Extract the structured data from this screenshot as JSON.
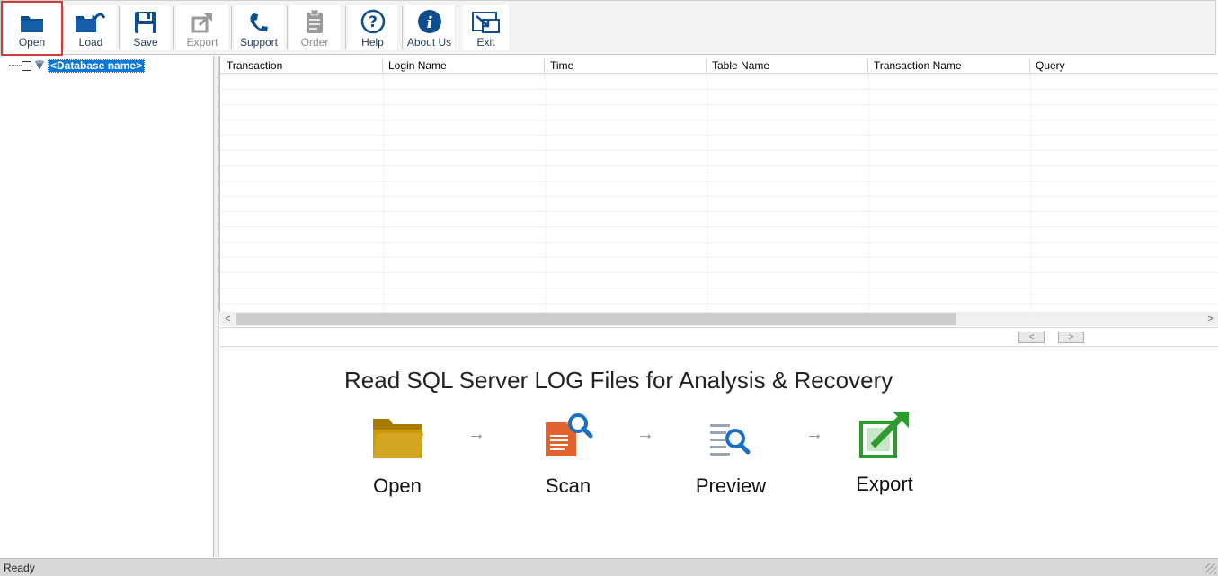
{
  "toolbar": {
    "open": "Open",
    "load": "Load",
    "save": "Save",
    "export": "Export",
    "support": "Support",
    "order": "Order",
    "help": "Help",
    "about": "About Us",
    "exit": "Exit"
  },
  "tree": {
    "root_label": "<Database name>"
  },
  "grid": {
    "columns": [
      "Transaction",
      "Login Name",
      "Time",
      "Table Name",
      "Transaction Name",
      "Query"
    ]
  },
  "scroll": {
    "left": "<",
    "right": ">"
  },
  "pager": {
    "prev": "<",
    "next": ">"
  },
  "info": {
    "title": "Read SQL Server LOG Files for Analysis & Recovery",
    "steps": [
      "Open",
      "Scan",
      "Preview",
      "Export"
    ],
    "arrow": "→"
  },
  "status": {
    "text": "Ready"
  },
  "colors": {
    "accent": "#0a5aa5",
    "folder": "#c99a06",
    "scan": "#e0622c",
    "export": "#2e9b2e",
    "selection": "#0a78d7"
  }
}
